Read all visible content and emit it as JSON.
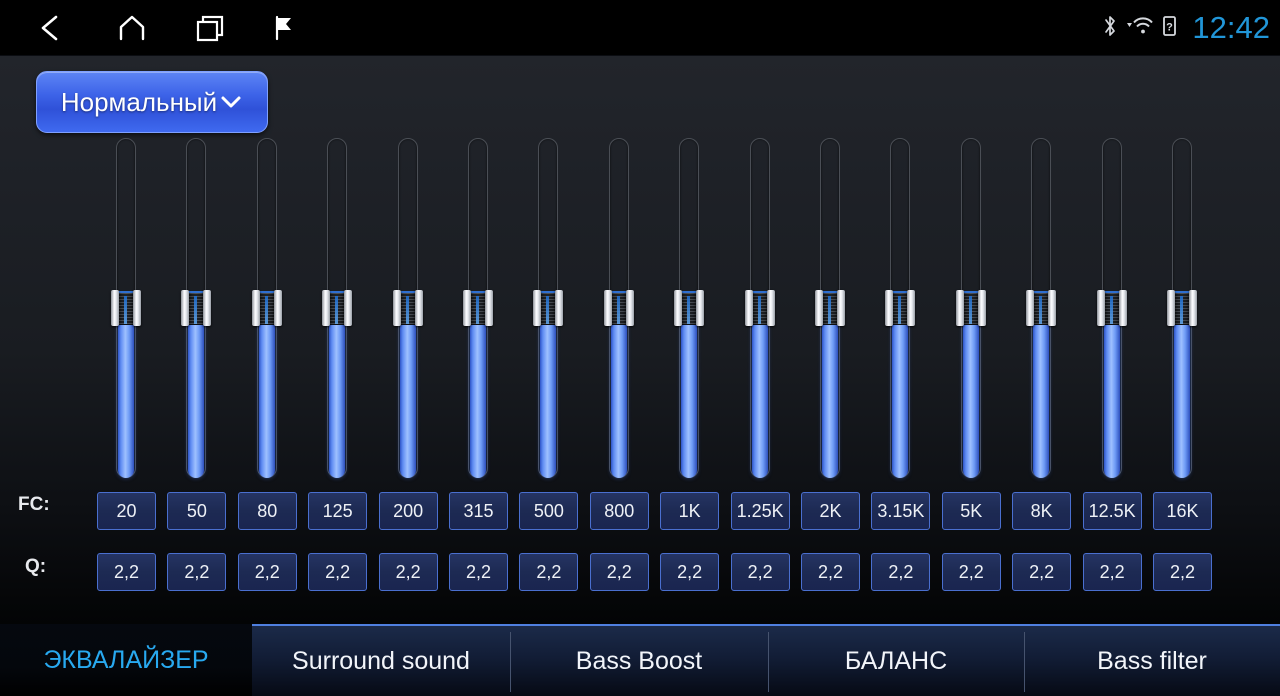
{
  "statusbar": {
    "nav": [
      {
        "name": "back-icon",
        "label": "Back"
      },
      {
        "name": "home-icon",
        "label": "Home"
      },
      {
        "name": "recents-icon",
        "label": "Recent apps"
      },
      {
        "name": "flag-icon",
        "label": "Flag"
      }
    ],
    "icons": [
      {
        "name": "bluetooth-icon",
        "label": "Bluetooth"
      },
      {
        "name": "wifi-icon",
        "label": "Wi-Fi"
      },
      {
        "name": "sim-unknown-icon",
        "label": "?"
      }
    ],
    "clock": "12:42"
  },
  "preset": {
    "label": "Нормальный",
    "caret": "chevron-down-icon"
  },
  "equalizer": {
    "fc_row_label": "FC:",
    "q_row_label": "Q:",
    "bands": [
      {
        "fc": "20",
        "q": "2,2",
        "level": 50
      },
      {
        "fc": "50",
        "q": "2,2",
        "level": 50
      },
      {
        "fc": "80",
        "q": "2,2",
        "level": 50
      },
      {
        "fc": "125",
        "q": "2,2",
        "level": 50
      },
      {
        "fc": "200",
        "q": "2,2",
        "level": 50
      },
      {
        "fc": "315",
        "q": "2,2",
        "level": 50
      },
      {
        "fc": "500",
        "q": "2,2",
        "level": 50
      },
      {
        "fc": "800",
        "q": "2,2",
        "level": 50
      },
      {
        "fc": "1K",
        "q": "2,2",
        "level": 50
      },
      {
        "fc": "1.25K",
        "q": "2,2",
        "level": 50
      },
      {
        "fc": "2K",
        "q": "2,2",
        "level": 50
      },
      {
        "fc": "3.15K",
        "q": "2,2",
        "level": 50
      },
      {
        "fc": "5K",
        "q": "2,2",
        "level": 50
      },
      {
        "fc": "8K",
        "q": "2,2",
        "level": 50
      },
      {
        "fc": "12.5K",
        "q": "2,2",
        "level": 50
      },
      {
        "fc": "16K",
        "q": "2,2",
        "level": 50
      }
    ]
  },
  "tabs": [
    {
      "label": "ЭКВАЛАЙЗЕР",
      "active": true
    },
    {
      "label": "Surround sound",
      "active": false
    },
    {
      "label": "Bass Boost",
      "active": false
    },
    {
      "label": "БАЛАНС",
      "active": false
    },
    {
      "label": "Bass filter",
      "active": false
    }
  ],
  "colors": {
    "accent_blue": "#28a9f0",
    "slider_blue": "#9ec0ff",
    "preset_blue": "#3d63e8",
    "box_border": "#4a6fcf",
    "box_fill": "#1d2a53"
  }
}
